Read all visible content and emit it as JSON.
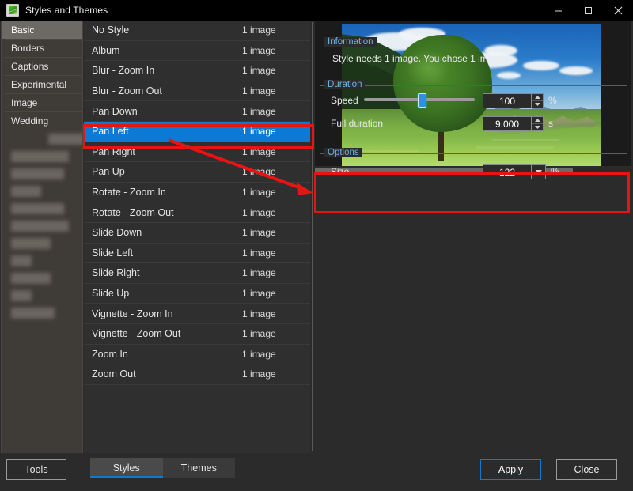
{
  "window": {
    "title": "Styles and Themes",
    "app_icon": "app-green-image-icon",
    "controls": {
      "minimize": "minimize-icon",
      "maximize": "maximize-icon",
      "close": "close-icon"
    }
  },
  "accent_colors": {
    "selection_blue": "#0b7ad6",
    "group_title_blue": "#6fb2e0",
    "annotation_red": "#e81313",
    "sidebar_bg": "#3f3b37",
    "sidebar_selected": "#6d6a66",
    "panel_bg": "#2b2b2b",
    "list_bg": "#2f2f2f"
  },
  "sidebar": {
    "items": [
      {
        "label": "Basic",
        "selected": true,
        "blurred": false
      },
      {
        "label": "Borders",
        "selected": false,
        "blurred": false
      },
      {
        "label": "Captions",
        "selected": false,
        "blurred": false
      },
      {
        "label": "Experimental",
        "selected": false,
        "blurred": false
      },
      {
        "label": "Image",
        "selected": false,
        "blurred": false
      },
      {
        "label": "Wedding",
        "selected": false,
        "blurred": false
      },
      {
        "label": "",
        "selected": false,
        "blurred": true
      },
      {
        "label": "",
        "selected": false,
        "blurred": true
      },
      {
        "label": "",
        "selected": false,
        "blurred": true
      },
      {
        "label": "",
        "selected": false,
        "blurred": true
      },
      {
        "label": "",
        "selected": false,
        "blurred": true
      },
      {
        "label": "",
        "selected": false,
        "blurred": true
      },
      {
        "label": "",
        "selected": false,
        "blurred": true
      },
      {
        "label": "",
        "selected": false,
        "blurred": true
      },
      {
        "label": "",
        "selected": false,
        "blurred": true
      },
      {
        "label": "",
        "selected": false,
        "blurred": true
      },
      {
        "label": "",
        "selected": false,
        "blurred": true
      }
    ]
  },
  "styles_list": {
    "count_suffix": "1 image",
    "rows": [
      {
        "name": "No Style",
        "count": "1 image",
        "selected": false
      },
      {
        "name": "Album",
        "count": "1 image",
        "selected": false
      },
      {
        "name": "Blur - Zoom In",
        "count": "1 image",
        "selected": false
      },
      {
        "name": "Blur - Zoom Out",
        "count": "1 image",
        "selected": false
      },
      {
        "name": "Pan Down",
        "count": "1 image",
        "selected": false
      },
      {
        "name": "Pan Left",
        "count": "1 image",
        "selected": true
      },
      {
        "name": "Pan Right",
        "count": "1 image",
        "selected": false
      },
      {
        "name": "Pan Up",
        "count": "1 image",
        "selected": false
      },
      {
        "name": "Rotate - Zoom In",
        "count": "1 image",
        "selected": false
      },
      {
        "name": "Rotate - Zoom Out",
        "count": "1 image",
        "selected": false
      },
      {
        "name": "Slide Down",
        "count": "1 image",
        "selected": false
      },
      {
        "name": "Slide Left",
        "count": "1 image",
        "selected": false
      },
      {
        "name": "Slide Right",
        "count": "1 image",
        "selected": false
      },
      {
        "name": "Slide Up",
        "count": "1 image",
        "selected": false
      },
      {
        "name": "Vignette - Zoom In",
        "count": "1 image",
        "selected": false
      },
      {
        "name": "Vignette - Zoom Out",
        "count": "1 image",
        "selected": false
      },
      {
        "name": "Zoom In",
        "count": "1 image",
        "selected": false
      },
      {
        "name": "Zoom Out",
        "count": "1 image",
        "selected": false
      }
    ]
  },
  "preview": {
    "image_description": "Alpine valley landscape with a large green tree, blue sky with white clouds, forested mountain slopes and green meadows"
  },
  "information": {
    "group_title": "Information",
    "message": "Style needs 1 image. You chose 1 image"
  },
  "duration": {
    "group_title": "Duration",
    "speed": {
      "label": "Speed",
      "value": "100",
      "unit": "%",
      "slider_percent": 50
    },
    "full_duration": {
      "label": "Full duration",
      "value": "9.000",
      "unit": "s"
    }
  },
  "options": {
    "group_title": "Options",
    "size": {
      "label": "Size",
      "value": "122",
      "unit": "%"
    }
  },
  "bottom_bar": {
    "tools_label": "Tools",
    "tabs": [
      {
        "label": "Styles",
        "active": true
      },
      {
        "label": "Themes",
        "active": false
      }
    ],
    "apply_label": "Apply",
    "close_label": "Close"
  },
  "annotations": {
    "selected_row_box": "red rectangle around Pan Left row",
    "information_box": "red rectangle around Information group",
    "arrow": "red arrow from Pan Left row to Information group"
  }
}
